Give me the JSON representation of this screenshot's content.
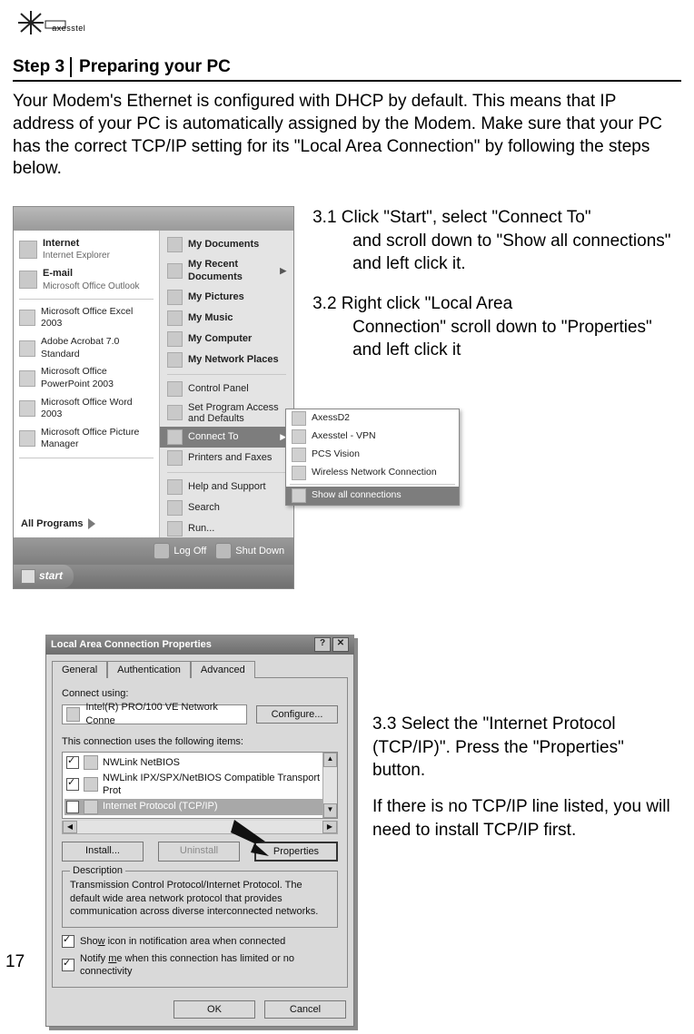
{
  "logo_text": "axesstel",
  "step_header": {
    "step": "Step 3",
    "title": "Preparing your PC"
  },
  "intro": "Your Modem's Ethernet is configured with DHCP by default. This means that IP address of your PC is automatically assigned by the Modem. Make sure that your PC has the correct TCP/IP setting for its \"Local Area Connection\" by following the steps below.",
  "steps": {
    "s31_head": "3.1 Click \"Start\", select \"Connect To\"",
    "s31_body": "and scroll down to \"Show all connections\" and left click it.",
    "s32_head": "3.2 Right click \"Local Area",
    "s32_body": "Connection\" scroll down to \"Properties\" and left click it",
    "s33a": "3.3 Select the \"Internet Protocol (TCP/IP)\". Press the \"Properties\" button.",
    "s33b": "If there is no TCP/IP line listed, you will need to install TCP/IP first."
  },
  "page_number": "17",
  "start_menu": {
    "pinned": [
      {
        "title": "Internet",
        "sub": "Internet Explorer"
      },
      {
        "title": "E-mail",
        "sub": "Microsoft Office Outlook"
      }
    ],
    "mfu": [
      "Microsoft Office Excel 2003",
      "Adobe Acrobat 7.0 Standard",
      "Microsoft Office PowerPoint 2003",
      "Microsoft Office Word 2003",
      "Microsoft Office Picture Manager"
    ],
    "all_programs": "All Programs",
    "right": [
      {
        "label": "My Documents",
        "bold": true
      },
      {
        "label": "My Recent Documents",
        "bold": true,
        "arrow": true
      },
      {
        "label": "My Pictures",
        "bold": true
      },
      {
        "label": "My Music",
        "bold": true
      },
      {
        "label": "My Computer",
        "bold": true
      },
      {
        "label": "My Network Places",
        "bold": true
      },
      {
        "label": "Control Panel",
        "bold": false
      },
      {
        "label": "Set Program Access and Defaults",
        "bold": false
      },
      {
        "label": "Connect To",
        "bold": false,
        "arrow": true,
        "selected": true
      },
      {
        "label": "Printers and Faxes",
        "bold": false
      },
      {
        "label": "Help and Support",
        "bold": false
      },
      {
        "label": "Search",
        "bold": false
      },
      {
        "label": "Run...",
        "bold": false
      }
    ],
    "flyout": [
      "AxessD2",
      "Axesstel - VPN",
      "PCS Vision",
      "Wireless Network Connection"
    ],
    "flyout_selected": "Show all connections",
    "logoff": "Log Off",
    "shutdown": "Shut Down",
    "start": "start"
  },
  "lan_dialog": {
    "title": "Local Area Connection Properties",
    "tabs": [
      "General",
      "Authentication",
      "Advanced"
    ],
    "connect_using": "Connect using:",
    "adapter": "Intel(R) PRO/100 VE Network Conne",
    "configure": "Configure...",
    "uses_items": "This connection uses the following items:",
    "items": [
      "NWLink NetBIOS",
      "NWLink IPX/SPX/NetBIOS Compatible Transport Prot",
      "Internet Protocol (TCP/IP)"
    ],
    "install": "Install...",
    "uninstall": "Uninstall",
    "properties": "Properties",
    "description_label": "Description",
    "description": "Transmission Control Protocol/Internet Protocol. The default wide area network protocol that provides communication across diverse interconnected networks.",
    "show_icon_pre": "Sho",
    "show_icon_u": "w",
    "show_icon_post": " icon in notification area when connected",
    "notify_pre": "Notify ",
    "notify_u": "m",
    "notify_post": "e when this connection has limited or no connectivity",
    "ok": "OK",
    "cancel": "Cancel"
  }
}
